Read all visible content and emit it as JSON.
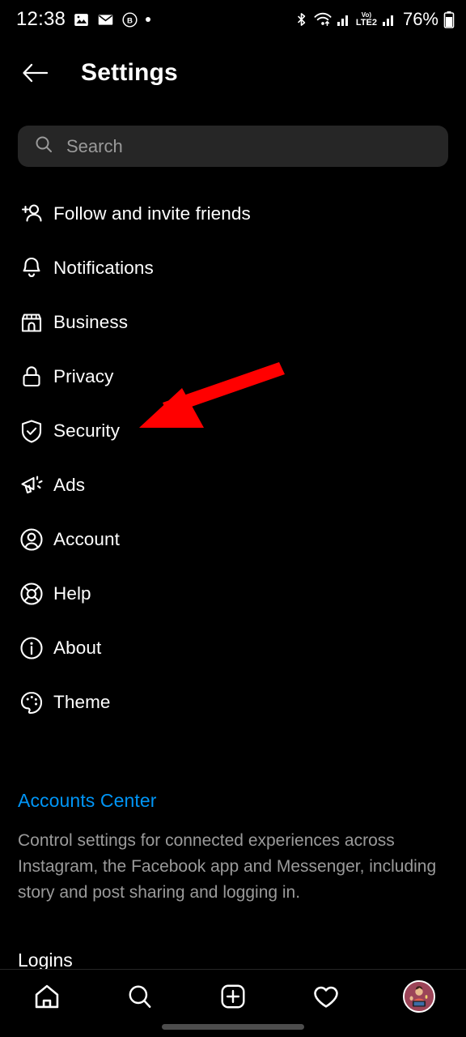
{
  "statusbar": {
    "time": "12:38",
    "left_icons": [
      "image-icon",
      "envelope-icon",
      "b-badge-icon",
      "dot-icon"
    ],
    "bluetooth": "bluetooth-icon",
    "wifi": "wifi-icon",
    "signal1": "signal-bars-icon",
    "volte_top": "Vo)",
    "volte_bottom": "LTE2",
    "signal2": "signal-bars-icon",
    "battery_percent": "76%",
    "battery_icon": "battery-icon"
  },
  "header": {
    "back_icon": "back-arrow-icon",
    "title": "Settings"
  },
  "search": {
    "icon": "search-icon",
    "placeholder": "Search",
    "value": ""
  },
  "menu": {
    "items": [
      {
        "label": "Follow and invite friends",
        "icon": "person-add-icon"
      },
      {
        "label": "Notifications",
        "icon": "bell-icon"
      },
      {
        "label": "Business",
        "icon": "storefront-icon"
      },
      {
        "label": "Privacy",
        "icon": "lock-icon"
      },
      {
        "label": "Security",
        "icon": "shield-check-icon"
      },
      {
        "label": "Ads",
        "icon": "megaphone-icon"
      },
      {
        "label": "Account",
        "icon": "account-circle-icon"
      },
      {
        "label": "Help",
        "icon": "life-ring-icon"
      },
      {
        "label": "About",
        "icon": "info-circle-icon"
      },
      {
        "label": "Theme",
        "icon": "palette-icon"
      }
    ]
  },
  "accounts_center": {
    "title": "Accounts Center",
    "description": "Control settings for connected experiences across Instagram, the Facebook app and Messenger, including story and post sharing and logging in.",
    "next_section": "Logins"
  },
  "annotation": {
    "arrow_color": "#FF0000",
    "points_at": "Security"
  },
  "bottom_nav": {
    "items": [
      {
        "icon": "home-icon"
      },
      {
        "icon": "search-icon"
      },
      {
        "icon": "plus-square-icon"
      },
      {
        "icon": "heart-icon"
      },
      {
        "icon": "profile-avatar"
      }
    ]
  },
  "colors": {
    "background": "#000000",
    "search_field": "#262626",
    "link_blue": "#0095F6",
    "secondary_text": "#9a9a9a",
    "accent_red": "#FF0000"
  }
}
